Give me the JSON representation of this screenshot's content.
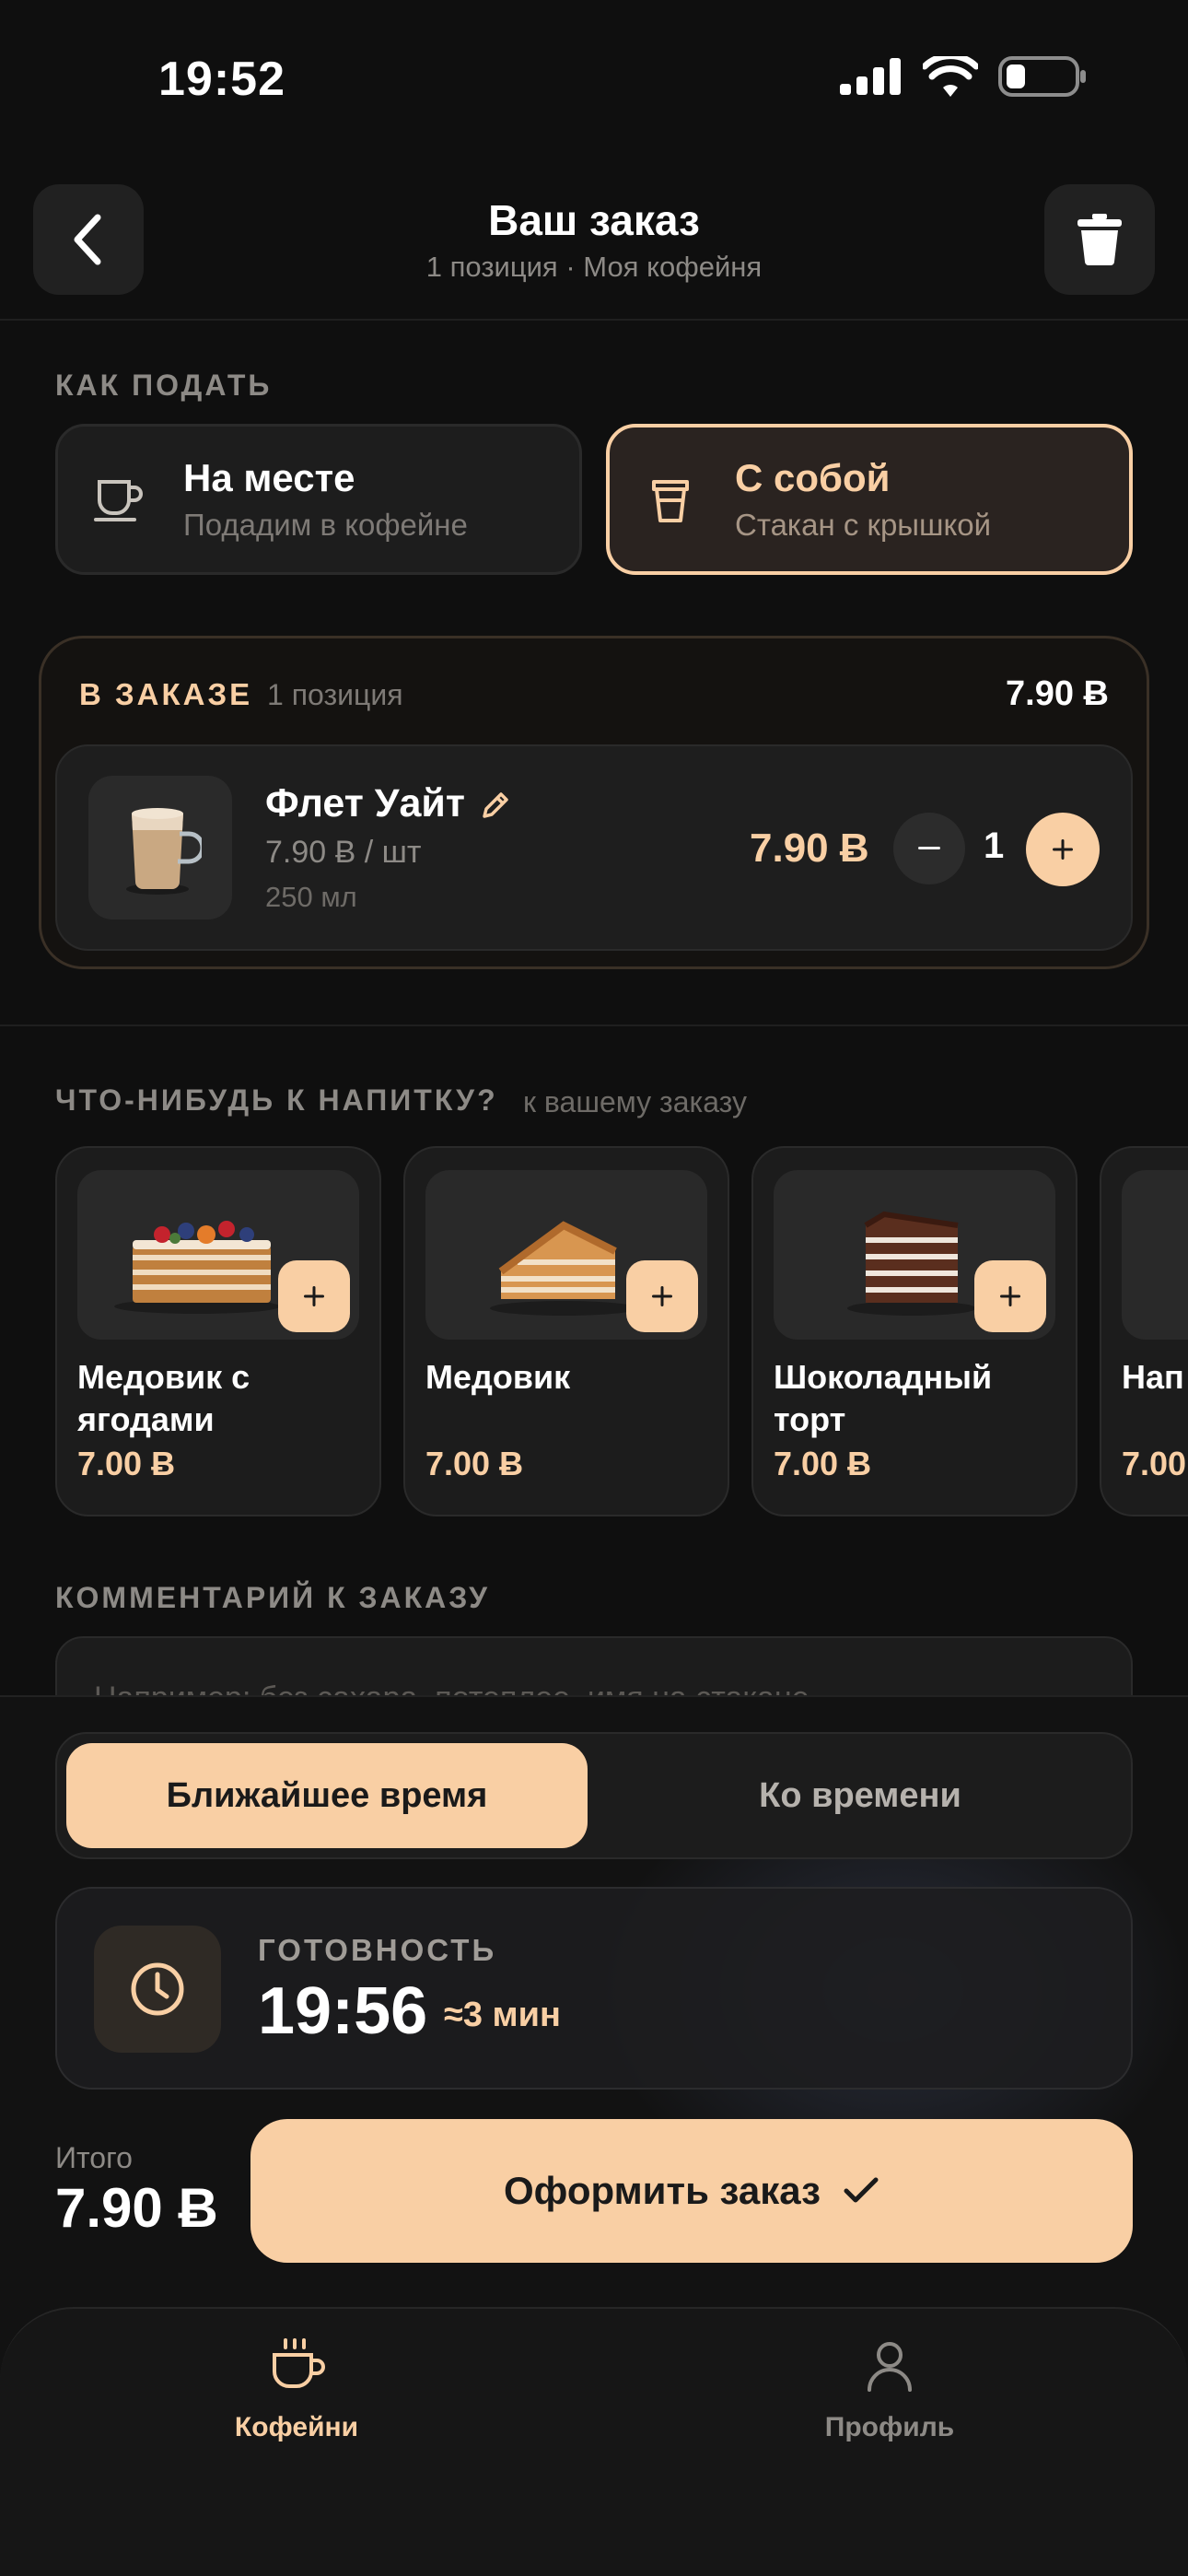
{
  "status_bar": {
    "time": "19:52"
  },
  "header": {
    "title": "Ваш заказ",
    "subtitle": "1 позиция · Моя кофейня"
  },
  "serve": {
    "label": "КАК ПОДАТЬ",
    "options": [
      {
        "title": "На месте",
        "subtitle": "Подадим в кофейне",
        "icon": "cup-icon",
        "selected": false
      },
      {
        "title": "С собой",
        "subtitle": "Стакан с крышкой",
        "icon": "takeaway-cup-icon",
        "selected": true
      }
    ]
  },
  "order": {
    "label": "В ЗАКАЗЕ",
    "count": "1 позиция",
    "total": "7.90 Ƀ",
    "items": [
      {
        "name": "Флет Уайт",
        "unit_price": "7.90 Ƀ / шт",
        "volume": "250 мл",
        "price": "7.90 Ƀ",
        "quantity": "1"
      }
    ]
  },
  "suggestions": {
    "label": "ЧТО-НИБУДЬ К НАПИТКУ?",
    "note": "к вашему заказу",
    "items": [
      {
        "name": "Медовик с ягодами",
        "price": "7.00 Ƀ"
      },
      {
        "name": "Медовик",
        "price": "7.00 Ƀ"
      },
      {
        "name": "Шоколадный торт",
        "price": "7.00 Ƀ"
      },
      {
        "name": "Нап",
        "price": "7.00"
      }
    ]
  },
  "comment": {
    "label": "КОММЕНТАРИЙ К ЗАКАЗУ",
    "placeholder": "Например: без сахара, потеплее, имя на стакане"
  },
  "timing": {
    "options": [
      "Ближайшее время",
      "Ко времени"
    ],
    "selected": "Ближайшее время",
    "ready_label": "ГОТОВНОСТЬ",
    "ready_time": "19:56",
    "eta": "≈3 мин"
  },
  "footer": {
    "total_label": "Итого",
    "total_value": "7.90 Ƀ",
    "checkout_label": "Оформить заказ"
  },
  "tabs": [
    {
      "label": "Кофейни",
      "icon": "coffee-cup-icon",
      "active": true
    },
    {
      "label": "Профиль",
      "icon": "user-icon",
      "active": false
    }
  ],
  "colors": {
    "accent": "#f9cfa4",
    "background": "#0f0f0f",
    "card": "#1e1e1e"
  }
}
